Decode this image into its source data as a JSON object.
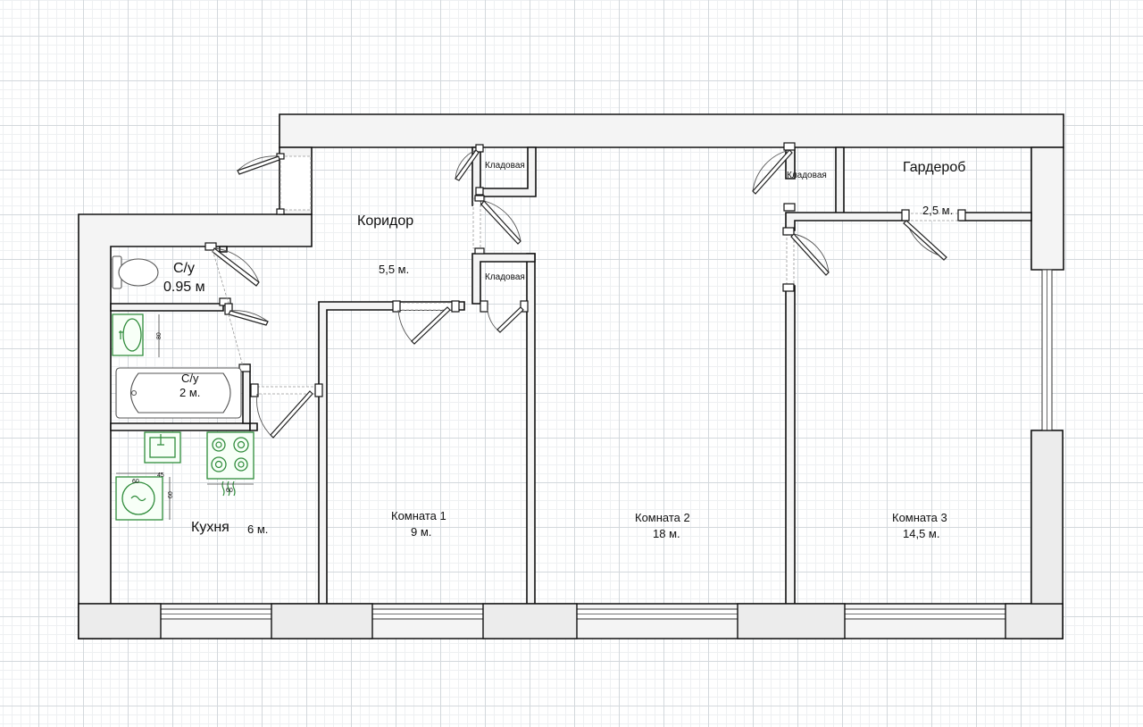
{
  "rooms": {
    "corridor": {
      "name": "Коридор",
      "area": "5,5 м."
    },
    "wc": {
      "name": "С/у",
      "area": "0.95 м"
    },
    "bath": {
      "name": "С/у",
      "area": "2 м."
    },
    "kitchen": {
      "name": "Кухня",
      "area": "6 м."
    },
    "room1": {
      "name": "Комната 1",
      "area": "9 м."
    },
    "room2": {
      "name": "Комната 2",
      "area": "18 м."
    },
    "room3": {
      "name": "Комната 3",
      "area": "14,5 м."
    },
    "wardrobe": {
      "name": "Гардероб",
      "area": "2,5 м."
    },
    "pantry1": {
      "name": "Кладовая"
    },
    "pantry2": {
      "name": "Кладовая"
    },
    "pantry3": {
      "name": "Кладовая"
    }
  },
  "dimensions": {
    "sink_depth": "80",
    "washer_width": "45",
    "washer_depth": "60",
    "washer_drum": "60",
    "stove_width": "60"
  },
  "colors": {
    "appliance": "#2e8b3a",
    "wall": "#111111",
    "grid": "#d3d8dc"
  }
}
